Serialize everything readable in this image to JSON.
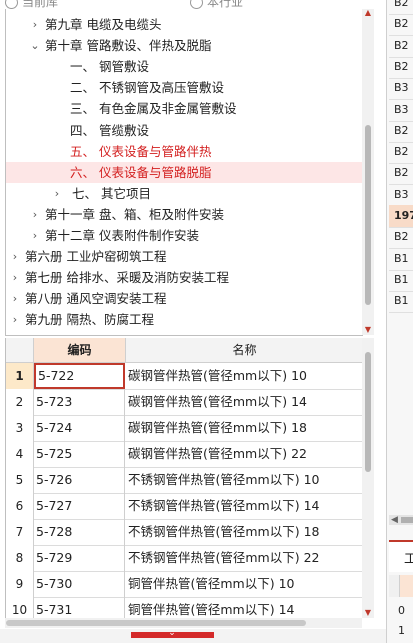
{
  "radio_options": [
    "当前库",
    "本行业"
  ],
  "tree": [
    {
      "label": "第九章 电缆及电缆头",
      "arrow": "›",
      "level": 1
    },
    {
      "label": "第十章 管路敷设、伴热及脱脂",
      "arrow": "⌄",
      "level": 1
    },
    {
      "label": "一、 钢管敷设",
      "arrow": "",
      "level": 2
    },
    {
      "label": "二、 不锈钢管及高压管敷设",
      "arrow": "",
      "level": 2
    },
    {
      "label": "三、 有色金属及非金属管敷设",
      "arrow": "",
      "level": 2
    },
    {
      "label": "四、 管缆敷设",
      "arrow": "",
      "level": 2
    },
    {
      "label": "五、 仪表设备与管路伴热",
      "arrow": "",
      "level": 2,
      "state": "highlighted"
    },
    {
      "label": "六、 仪表设备与管路脱脂",
      "arrow": "",
      "level": 2,
      "state": "selected"
    },
    {
      "label": "七、 其它项目",
      "arrow": "›",
      "level": 2
    },
    {
      "label": "第十一章 盘、箱、柜及附件安装",
      "arrow": "›",
      "level": 1
    },
    {
      "label": "第十二章 仪表附件制作安装",
      "arrow": "›",
      "level": 1
    },
    {
      "label": "第六册 工业炉窑砌筑工程",
      "arrow": "›",
      "level": 0
    },
    {
      "label": "第七册 给排水、采暖及消防安装工程",
      "arrow": "›",
      "level": 0
    },
    {
      "label": "第八册 通风空调安装工程",
      "arrow": "›",
      "level": 0
    },
    {
      "label": "第九册 隔热、防腐工程",
      "arrow": "›",
      "level": 0
    }
  ],
  "table": {
    "columns": [
      "编码",
      "名称"
    ],
    "rows": [
      {
        "n": "1",
        "code": "5-722",
        "name": "碳钢管伴热管(管径mm以下) 10"
      },
      {
        "n": "2",
        "code": "5-723",
        "name": "碳钢管伴热管(管径mm以下) 14"
      },
      {
        "n": "3",
        "code": "5-724",
        "name": "碳钢管伴热管(管径mm以下) 18"
      },
      {
        "n": "4",
        "code": "5-725",
        "name": "碳钢管伴热管(管径mm以下) 22"
      },
      {
        "n": "5",
        "code": "5-726",
        "name": "不锈钢管伴热管(管径mm以下) 10"
      },
      {
        "n": "6",
        "code": "5-727",
        "name": "不锈钢管伴热管(管径mm以下) 14"
      },
      {
        "n": "7",
        "code": "5-728",
        "name": "不锈钢管伴热管(管径mm以下) 18"
      },
      {
        "n": "8",
        "code": "5-729",
        "name": "不锈钢管伴热管(管径mm以下) 22"
      },
      {
        "n": "9",
        "code": "5-730",
        "name": "铜管伴热管(管径mm以下) 10"
      },
      {
        "n": "10",
        "code": "5-731",
        "name": "铜管伴热管(管径mm以下) 14"
      }
    ],
    "active_row": 0
  },
  "right_panel": {
    "cells": [
      "B2",
      "B2",
      "B2",
      "B2",
      "B3",
      "B3",
      "B2",
      "B2",
      "B2",
      "B3",
      "197",
      "B2",
      "B1",
      "B1",
      "B1"
    ],
    "highlight_index": 10,
    "tab_char": "工",
    "grid_row1": "0",
    "grid_row2": "1"
  },
  "colors": {
    "accent": "#d42a2a",
    "selected_row": "#fde6e6",
    "header_active": "#fbe4d4"
  }
}
